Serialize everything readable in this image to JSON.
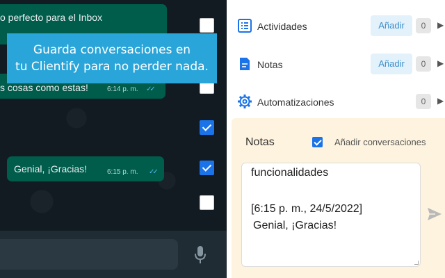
{
  "chat": {
    "messages": [
      {
        "text": "o perfecto para el Inbox",
        "time": "",
        "checked": false
      },
      {
        "text": "s cosas como estas!",
        "time": "6:14 p. m.",
        "ticks": "✓✓",
        "checked": false
      },
      {
        "text": "Genial, ¡Gracias!",
        "time": "6:15 p. m.",
        "ticks": "✓✓",
        "checked": true
      }
    ],
    "extra_checkboxes": [
      true,
      false
    ]
  },
  "banner": {
    "line1": "Guarda conversaciones en",
    "line2": "tu Clientify para no perder nada."
  },
  "crm": {
    "sections": [
      {
        "label": "Actividades",
        "add_label": "Añadir",
        "count": "0",
        "icon": "list-icon"
      },
      {
        "label": "Notas",
        "add_label": "Añadir",
        "count": "0",
        "icon": "document-icon"
      },
      {
        "label": "Automatizaciones",
        "count": "0",
        "icon": "gear-icon"
      }
    ],
    "notes_panel": {
      "title": "Notas",
      "add_conversations_label": "Añadir conversaciones",
      "add_conversations_checked": true,
      "note_lines": [
        "funcionalidades",
        "[6:15 p. m., 24/5/2022]",
        "Genial, ¡Gracias!"
      ]
    }
  },
  "icons": {
    "caret": "▶",
    "send": "send-icon",
    "mic": "microphone-icon"
  },
  "colors": {
    "chat_bg": "#121b22",
    "bubble": "#005c4b",
    "banner": "#29a5d9",
    "accent_blue": "#1a73e8",
    "notes_bg": "#fdf3de"
  }
}
